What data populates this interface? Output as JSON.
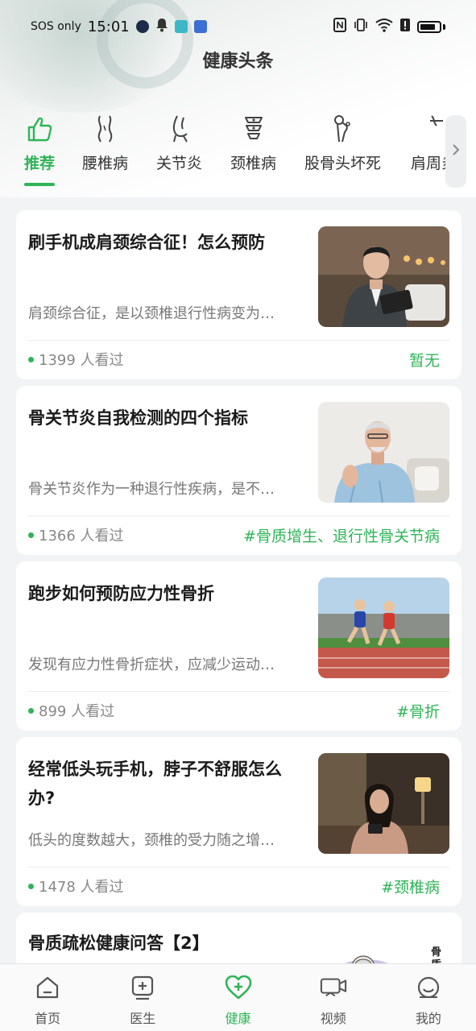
{
  "status_bar": {
    "carrier": "SOS only",
    "time": "15:01"
  },
  "page_title": "健康头条",
  "categories": [
    {
      "label": "推荐",
      "icon": "thumbs-up-icon",
      "active": true
    },
    {
      "label": "腰椎病",
      "icon": "lumbar-icon",
      "active": false
    },
    {
      "label": "关节炎",
      "icon": "joint-icon",
      "active": false
    },
    {
      "label": "颈椎病",
      "icon": "cervical-spine-icon",
      "active": false
    },
    {
      "label": "股骨头坏死",
      "icon": "femoral-head-icon",
      "active": false
    },
    {
      "label": "肩周炎",
      "icon": "shoulder-icon",
      "active": false
    }
  ],
  "articles": [
    {
      "title": "刷手机成肩颈综合征！怎么预防",
      "summary": "肩颈综合征，是以颈椎退行性病变为…",
      "views": "1399 人看过",
      "tag": "暂无",
      "image": "man-with-tablet-photo"
    },
    {
      "title": "骨关节炎自我检测的四个指标",
      "summary": "骨关节炎作为一种退行性疾病，是不…",
      "views": "1366 人看过",
      "tag": "#骨质增生、退行性骨关节病",
      "image": "elderly-man-shoulder-pain-photo"
    },
    {
      "title": "跑步如何预防应力性骨折",
      "summary": "发现有应力性骨折症状，应减少运动…",
      "views": "899 人看过",
      "tag": "#骨折",
      "image": "runners-on-track-photo"
    },
    {
      "title": "经常低头玩手机，脖子不舒服怎么办?",
      "summary": "低头的度数越大，颈椎的受力随之增…",
      "views": "1478 人看过",
      "tag": "#颈椎病",
      "image": "woman-using-phone-photo"
    },
    {
      "title": "骨质疏松健康问答【2】",
      "summary": "",
      "views": "",
      "tag": "",
      "image": "osteoporosis-cartoon",
      "image_text": "骨质疏"
    }
  ],
  "bottom_nav": [
    {
      "label": "首页",
      "icon": "home-icon",
      "active": false
    },
    {
      "label": "医生",
      "icon": "doctor-icon",
      "active": false
    },
    {
      "label": "健康",
      "icon": "health-heart-icon",
      "active": true
    },
    {
      "label": "视频",
      "icon": "video-icon",
      "active": false
    },
    {
      "label": "我的",
      "icon": "profile-icon",
      "active": false
    }
  ],
  "colors": {
    "accent": "#2fb457",
    "background": "#f2f3f5"
  }
}
